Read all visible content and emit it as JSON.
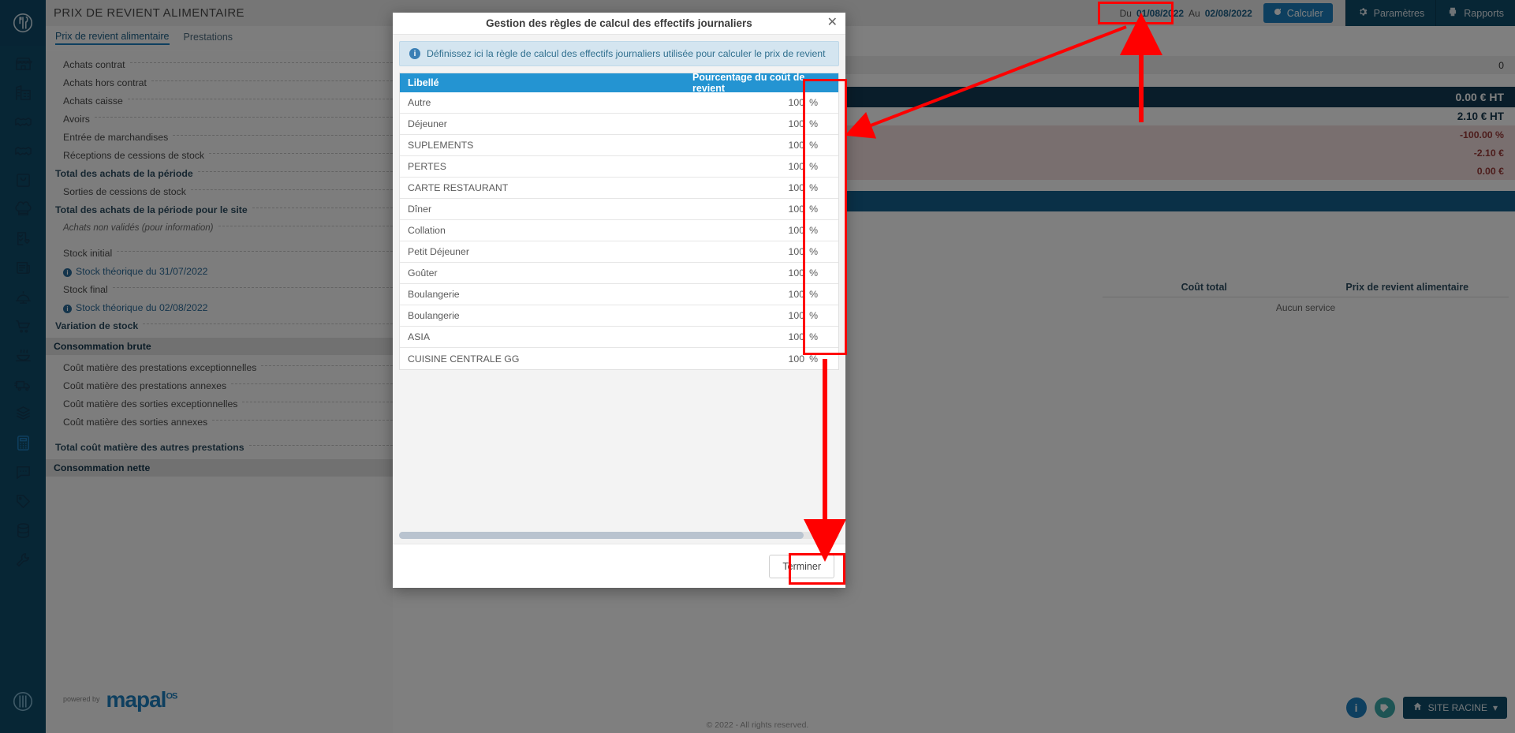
{
  "app": {
    "brand": "mapal",
    "brand_sup": "OS",
    "powered_line1": "powered by",
    "copyright": "© 2022 - All rights reserved."
  },
  "sidebar": {
    "items": [
      {
        "name": "logo-restaurant-icon",
        "label": "Accueil"
      },
      {
        "name": "store-icon",
        "label": "Établissements"
      },
      {
        "name": "building-chart-icon",
        "label": "Analyse"
      },
      {
        "name": "handshake-icon",
        "label": "Contrats"
      },
      {
        "name": "handshake-alt-icon",
        "label": "Fournisseurs"
      },
      {
        "name": "bag-icon",
        "label": "Achats"
      },
      {
        "name": "chef-hat-icon",
        "label": "Recettes"
      },
      {
        "name": "checklist-heart-icon",
        "label": "Qualité"
      },
      {
        "name": "newspaper-icon",
        "label": "Documents"
      },
      {
        "name": "cloche-icon",
        "label": "Prestations"
      },
      {
        "name": "cart-icon",
        "label": "Commandes"
      },
      {
        "name": "hot-bowl-icon",
        "label": "Production"
      },
      {
        "name": "truck-icon",
        "label": "Livraisons"
      },
      {
        "name": "boxes-icon",
        "label": "Stocks"
      },
      {
        "name": "calculator-icon",
        "label": "Prix de revient"
      },
      {
        "name": "chat-icon",
        "label": "Messages"
      },
      {
        "name": "tag-icon",
        "label": "Étiquettes"
      },
      {
        "name": "database-icon",
        "label": "Données"
      },
      {
        "name": "wrench-icon",
        "label": "Outils"
      }
    ]
  },
  "header": {
    "title": "PRIX DE REVIENT ALIMENTAIRE",
    "date_from_label": "Du",
    "date_from_value": "01/08/2022",
    "date_to_label": "Au",
    "date_to_value": "02/08/2022",
    "calculate_label": "Calculer",
    "settings_label": "Paramètres",
    "reports_label": "Rapports"
  },
  "tabs": [
    {
      "label": "Prix de revient alimentaire",
      "active": true
    },
    {
      "label": "Prestations",
      "active": false
    }
  ],
  "breakdown": {
    "rows": [
      {
        "label": "Achats contrat",
        "style": "normal",
        "value": ""
      },
      {
        "label": "Achats hors contrat",
        "style": "normal",
        "value": ""
      },
      {
        "label": "Achats caisse",
        "style": "normal",
        "value": ""
      },
      {
        "label": "Avoirs",
        "style": "normal",
        "value": ""
      },
      {
        "label": "Entrée de marchandises",
        "style": "normal",
        "value": ""
      },
      {
        "label": "Réceptions de cessions de stock",
        "style": "normal",
        "value": ""
      },
      {
        "label": "Total des achats de la période",
        "style": "bold",
        "value": ""
      },
      {
        "label": "Sorties de cessions de stock",
        "style": "normal",
        "value": ""
      },
      {
        "label": "Total des achats de la période pour le site",
        "style": "bold",
        "value": ""
      },
      {
        "label": "Achats non validés (pour information)",
        "style": "italic",
        "value": ""
      },
      {
        "label": "",
        "style": "gap",
        "value": ""
      },
      {
        "label": "Stock initial",
        "style": "normal",
        "value": ""
      },
      {
        "label": "Stock théorique du 31/07/2022",
        "style": "link",
        "value": ""
      },
      {
        "label": "Stock final",
        "style": "normal",
        "value": ""
      },
      {
        "label": "Stock théorique du 02/08/2022",
        "style": "link",
        "value": ""
      },
      {
        "label": "Variation de stock",
        "style": "bold",
        "value": ""
      },
      {
        "label": "Consommation brute",
        "style": "section",
        "value": ""
      },
      {
        "label": "Coût matière des prestations exceptionnelles",
        "style": "normal",
        "value": ""
      },
      {
        "label": "Coût matière des prestations annexes",
        "style": "normal",
        "value": ""
      },
      {
        "label": "Coût matière des sorties exceptionnelles",
        "style": "normal",
        "value": ""
      },
      {
        "label": "Coût matière des sorties annexes",
        "style": "normal",
        "value": ""
      },
      {
        "label": "Total coût matière des autres prestations",
        "style": "bold",
        "value": ""
      },
      {
        "label": "Consommation nette",
        "style": "section",
        "value": ""
      }
    ]
  },
  "values": {
    "rows": [
      {
        "value": "",
        "style": "plain"
      },
      {
        "value": "0",
        "style": "strip"
      },
      {
        "value": "",
        "style": "plain"
      },
      {
        "value": "0.00 € HT",
        "style": "navy"
      },
      {
        "value": "2.10 € HT",
        "style": "bold"
      },
      {
        "value": "-100.00 %",
        "style": "warn"
      },
      {
        "value": "-2.10 €",
        "style": "warn"
      },
      {
        "value": "0.00 €",
        "style": "warn"
      },
      {
        "value": "",
        "style": "plain"
      },
      {
        "value": "",
        "style": "banner"
      }
    ]
  },
  "service_table": {
    "columns": [
      "Coût total",
      "Prix de revient alimentaire"
    ],
    "empty_text": "Aucun service"
  },
  "footer": {
    "site_label": "SITE RACINE",
    "info_icon": "info-icon",
    "help_icon": "support-icon",
    "home_icon": "home-icon"
  },
  "modal": {
    "title": "Gestion des règles de calcul des effectifs journaliers",
    "close_label": "✕",
    "info_text": "Définissez ici la règle de calcul des effectifs journaliers utilisée pour calculer le prix de revient",
    "columns": {
      "label": "Libellé",
      "percent": "Pourcentage du coût de revient"
    },
    "percent_sign": "%",
    "rows": [
      {
        "label": "Autre",
        "percent": "100"
      },
      {
        "label": "Déjeuner",
        "percent": "100"
      },
      {
        "label": "SUPLEMENTS",
        "percent": "100"
      },
      {
        "label": "PERTES",
        "percent": "100"
      },
      {
        "label": "CARTE RESTAURANT",
        "percent": "100"
      },
      {
        "label": "Dîner",
        "percent": "100"
      },
      {
        "label": "Collation",
        "percent": "100"
      },
      {
        "label": "Petit Déjeuner",
        "percent": "100"
      },
      {
        "label": "Goûter",
        "percent": "100"
      },
      {
        "label": "Boulangerie",
        "percent": "100"
      },
      {
        "label": "Boulangerie",
        "percent": "100"
      },
      {
        "label": "ASIA",
        "percent": "100"
      },
      {
        "label": "CUISINE CENTRALE GG",
        "percent": "100"
      }
    ],
    "finish_label": "Terminer"
  },
  "annotations": {
    "color": "#ff0000",
    "highlight_settings": true,
    "highlight_percent_column": true,
    "highlight_finish_button": true
  },
  "colors": {
    "brand_navy": "#0f4c6b",
    "accent_blue": "#1c7fbe",
    "table_header_blue": "#2494d2",
    "warn_bg": "#f2dede",
    "annotation_red": "#ff0000"
  }
}
